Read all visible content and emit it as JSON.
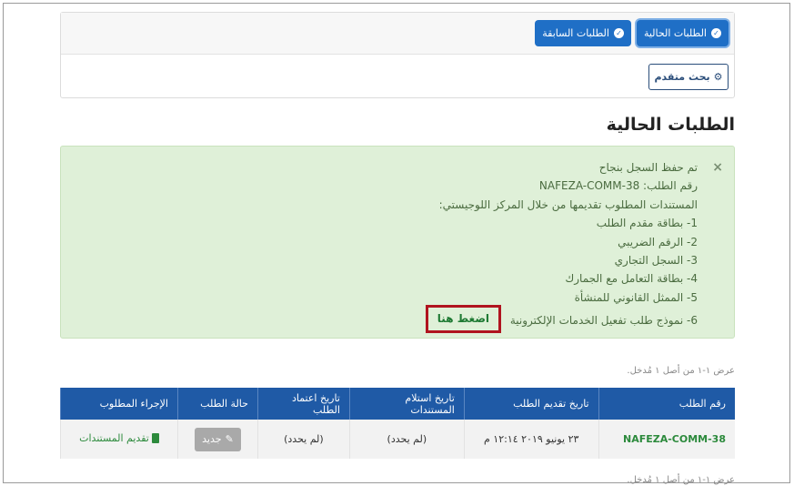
{
  "tabs": [
    {
      "label": "الطلبات الحالية",
      "active": true
    },
    {
      "label": "الطلبات السابقة",
      "active": false
    }
  ],
  "advanced_search_label": "بحث متقدم",
  "page_title": "الطلبات الحالية",
  "alert": {
    "close": "×",
    "lines": [
      "تم حفظ السجل بنجاح",
      "رقم الطلب: NAFEZA-COMM-38",
      "المستندات المطلوب تقديمها من خلال المركز اللوجيستي:",
      "1- بطاقة مقدم الطلب",
      "2- الرقم الضريبي",
      "3- السجل التجاري",
      "4- بطاقة التعامل مع الجمارك",
      "5- الممثل القانوني للمنشأة",
      "6- نموذج طلب تفعيل الخدمات الإلكترونية"
    ],
    "click_here": "اضغط هنا"
  },
  "showing_text": "عرض ١-١ من أصل ١ مُدخل.",
  "table": {
    "headers": [
      "رقم الطلب",
      "تاريخ تقديم الطلب",
      "تاريخ استلام المستندات",
      "تاريخ اعتماد الطلب",
      "حالة الطلب",
      "الإجراء المطلوب"
    ],
    "row": {
      "request_no": "NAFEZA-COMM-38",
      "submit_date": "٢٣ يونيو ٢٠١٩ ١٢:١٤ م",
      "receive_date": "(لم يحدد)",
      "approve_date": "(لم يحدد)",
      "status": "جديد",
      "action": "تقديم المستندات"
    }
  },
  "colors": {
    "primary": "#1f5aa6",
    "success_bg": "#dff0d8",
    "highlight": "#b0141f"
  }
}
